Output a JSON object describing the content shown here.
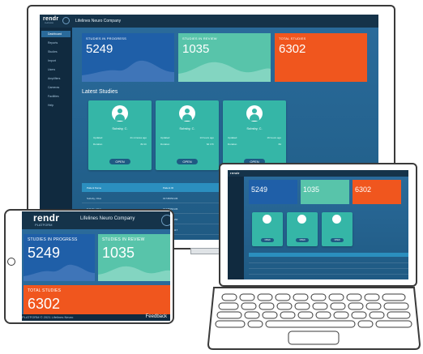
{
  "brand": {
    "logo": "rendr",
    "logo_sub": "PLATFORM",
    "company": "Lifelines Neuro Company"
  },
  "sidebar": {
    "items": [
      "Dashboard",
      "Reports",
      "Studies",
      "Import",
      "Users",
      "Amplifiers",
      "Cameras",
      "Facilities",
      "Help"
    ]
  },
  "cards": {
    "in_progress": {
      "label": "STUDIES IN PROGRESS",
      "value": "5249"
    },
    "in_review": {
      "label": "STUDIES IN REVIEW",
      "value": "1035"
    },
    "total": {
      "label": "TOTAL STUDIES",
      "value": "6302"
    }
  },
  "latest": {
    "heading": "Latest Studies",
    "items": [
      {
        "name": "Subsby, C.",
        "row1_label": "Updated",
        "row1_value": "21 minutes ago",
        "row2_label": "Duration",
        "row2_value": "8d 1h",
        "button": "OPEN"
      },
      {
        "name": "Subsby, C.",
        "row1_label": "Updated",
        "row1_value": "13 hours ago",
        "row2_label": "Duration",
        "row2_value": "6d 17h",
        "button": "OPEN"
      },
      {
        "name": "Subsby, C.",
        "row1_label": "Updated",
        "row1_value": "16 hours ago",
        "row2_label": "Duration",
        "row2_value": "8d",
        "button": "OPEN"
      }
    ]
  },
  "table": {
    "headers": [
      "Patient Name",
      "Patient ID"
    ],
    "rows": [
      [
        "Subsby, Clive",
        "01745654136"
      ],
      [
        "Subsby, Clive",
        "01745654136"
      ],
      [
        "Subsby, Clive",
        "01745654150"
      ],
      [
        "Subsby, Clive",
        "01745654117"
      ]
    ]
  },
  "footer": {
    "copyright": "PLATFORM © 2021 Lifelines Neuro",
    "feedback": "Feedback"
  },
  "colors": {
    "blue_card": "#1f5fa8",
    "teal_card": "#58c4aa",
    "orange_card": "#f0561e",
    "study_card": "#35b6a7",
    "bg": "#2a6a9a"
  }
}
